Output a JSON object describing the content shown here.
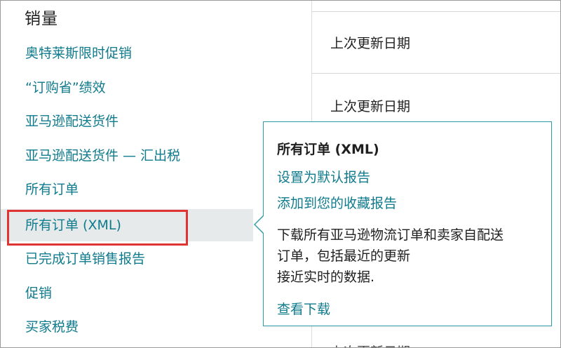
{
  "menu": {
    "heading": "销量",
    "items": [
      {
        "label": "奥特莱斯限时促销"
      },
      {
        "label": "“订购省”绩效"
      },
      {
        "label": "亚马逊配送货件"
      },
      {
        "label": "亚马逊配送货件 — 汇出税"
      },
      {
        "label": "所有订单"
      },
      {
        "label": "所有订单 (XML)"
      },
      {
        "label": "已完成订单销售报告"
      },
      {
        "label": "促销"
      },
      {
        "label": "买家税费"
      }
    ],
    "selected_index": 5
  },
  "right": {
    "rows": [
      {
        "label": "上次更新日期"
      },
      {
        "label": "上次更新日期"
      }
    ],
    "partial_text": "上次更新日期"
  },
  "popover": {
    "title": "所有订单 (XML)",
    "link_default": "设置为默认报告",
    "link_favorite": "添加到您的收藏报告",
    "desc_line1": "下载所有亚马逊物流订单和卖家自配送",
    "desc_line2": "订单，包括最近的更新",
    "desc_line3": "接近实时的数据.",
    "link_download": "查看下载"
  },
  "colors": {
    "link": "#0f7b8c",
    "selected_bg": "#e6eaeb",
    "highlight_box": "#e03333",
    "popover_border": "#2f9ca8"
  }
}
